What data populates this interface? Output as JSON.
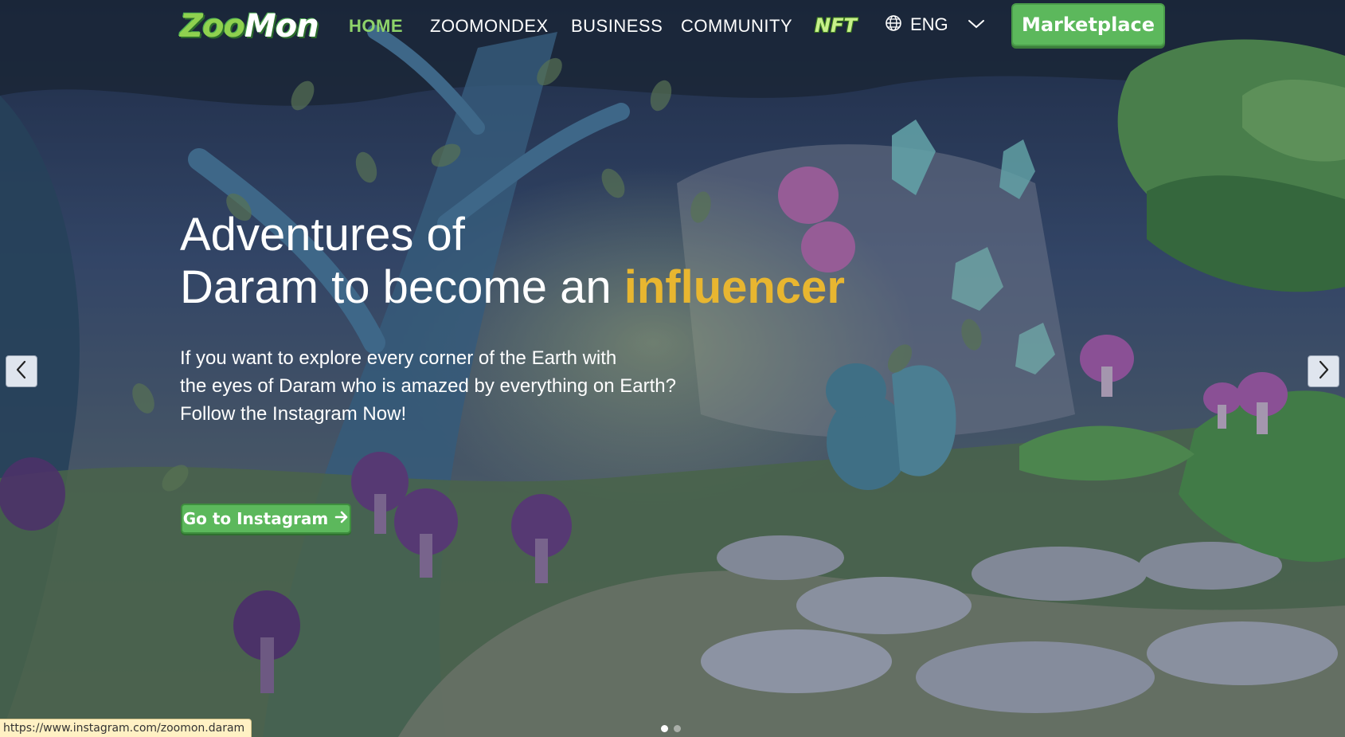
{
  "logo": {
    "text_a": "Zoo",
    "text_b": "Mon"
  },
  "nav": {
    "items": [
      {
        "label": "HOME",
        "active": true
      },
      {
        "label": "ZOOMONDEX",
        "active": false
      },
      {
        "label": "BUSINESS",
        "active": false
      },
      {
        "label": "COMMUNITY",
        "active": false
      }
    ],
    "nft_label": "NFT",
    "language": "ENG",
    "marketplace_label": "Marketplace"
  },
  "hero": {
    "headline_line1": "Adventures of",
    "headline_line2_prefix": "Daram to become an ",
    "headline_highlight": "influencer",
    "body_lines": [
      "If you want to explore every corner of the Earth with",
      "the eyes of Daram who is amazed by everything on Earth?",
      "Follow the Instagram Now!"
    ],
    "cta_label": "Go to Instagram"
  },
  "carousel": {
    "slide_count": 2,
    "active_index": 0
  },
  "status_bar": {
    "url": "https://www.instagram.com/zoomon.daram"
  },
  "colors": {
    "accent_green": "#5cb85c",
    "nav_active": "#8ed36a",
    "highlight_yellow": "#e8b630"
  },
  "icons": {
    "globe": "globe-icon",
    "chevron": "chevron-down-icon",
    "arrow": "arrow-right-icon",
    "prev": "chevron-left-icon",
    "next": "chevron-right-icon"
  }
}
